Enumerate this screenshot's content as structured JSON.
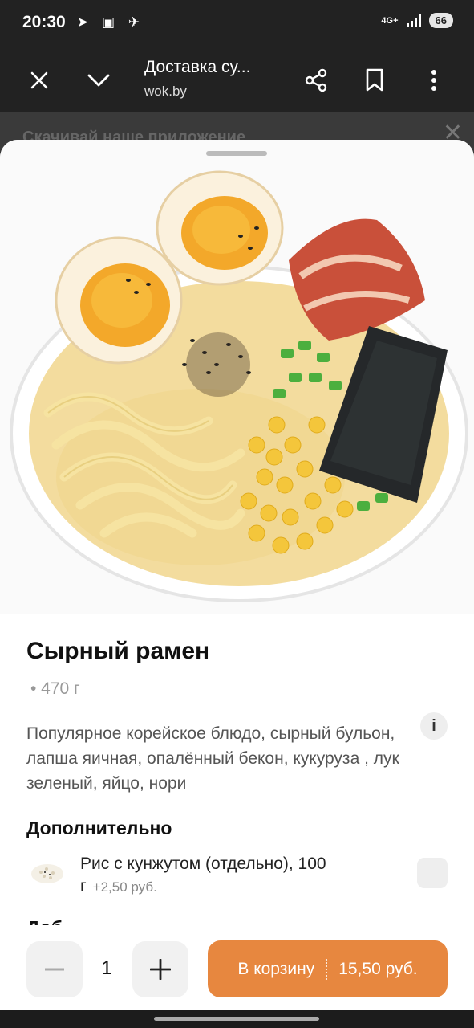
{
  "status_bar": {
    "time": "20:30",
    "network": "4G+",
    "battery": "66"
  },
  "browser": {
    "title": "Доставка су...",
    "url": "wok.by"
  },
  "behind": {
    "banner_text": "Скачивай наше приложение"
  },
  "product": {
    "title": "Сырный рамен",
    "weight": "• 470 г",
    "description": "Популярное корейское блюдо, сырный бульон, лапша яичная, опалённый бекон, кукуруза , лук зеленый, яйцо, нори",
    "info_icon": "i"
  },
  "extras": {
    "heading": "Дополнительно",
    "items": [
      {
        "name": "Рис с кунжутом (отдельно), 100 г",
        "price": "+2,50 руб."
      }
    ],
    "next_heading_partial": "Доб"
  },
  "cart": {
    "quantity": "1",
    "add_label": "В корзину",
    "total": "15,50 руб.",
    "accent_color": "#e7873f"
  },
  "icons": [
    "close-icon",
    "chevron-down-icon",
    "share-icon",
    "bookmark-icon",
    "more-vert-icon",
    "info-icon",
    "minus-icon",
    "plus-icon"
  ]
}
